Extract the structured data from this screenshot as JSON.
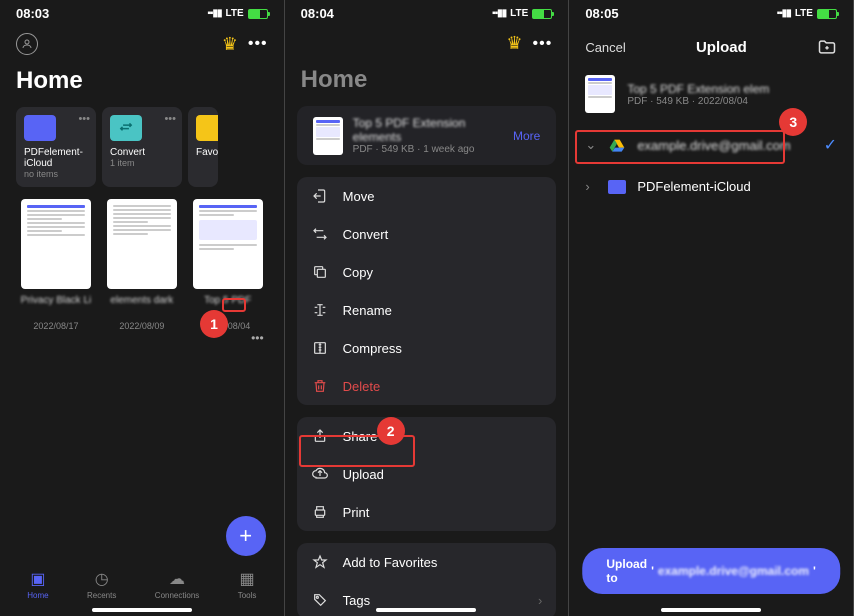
{
  "panel1": {
    "time": "08:03",
    "lte": "LTE",
    "title": "Home",
    "folders": [
      {
        "name": "PDFelement-iCloud",
        "sub": "no items"
      },
      {
        "name": "Convert",
        "sub": "1 item"
      },
      {
        "name": "Favori",
        "sub": ""
      }
    ],
    "docs": [
      {
        "title": "Privacy Black Li",
        "date": "2022/08/17"
      },
      {
        "title": "elements dark",
        "date": "2022/08/09"
      },
      {
        "title": "Top 5 PDF",
        "date": "2022/08/04"
      }
    ],
    "tabs": {
      "home": "Home",
      "recents": "Recents",
      "connections": "Connections",
      "tools": "Tools"
    },
    "badge1": "1"
  },
  "panel2": {
    "time": "08:04",
    "title": "Home",
    "file": {
      "name": "Top 5 PDF Extension elements",
      "meta": "PDF · 549 KB · 1 week ago"
    },
    "more": "More",
    "actions": {
      "move": "Move",
      "convert": "Convert",
      "copy": "Copy",
      "rename": "Rename",
      "compress": "Compress",
      "delete": "Delete",
      "share": "Share",
      "upload": "Upload",
      "print": "Print",
      "favorites": "Add to Favorites",
      "tags": "Tags"
    },
    "badge2": "2"
  },
  "panel3": {
    "time": "08:05",
    "cancel": "Cancel",
    "title": "Upload",
    "file": {
      "name": "Top 5 PDF Extension elem",
      "meta": "PDF · 549 KB · 2022/08/04"
    },
    "gdrive": "example.drive@gmail.com",
    "icloud": "PDFelement-iCloud",
    "uploadPrefix": "Upload to ",
    "uploadEmail": "example.drive@gmail.com",
    "badge3": "3"
  }
}
